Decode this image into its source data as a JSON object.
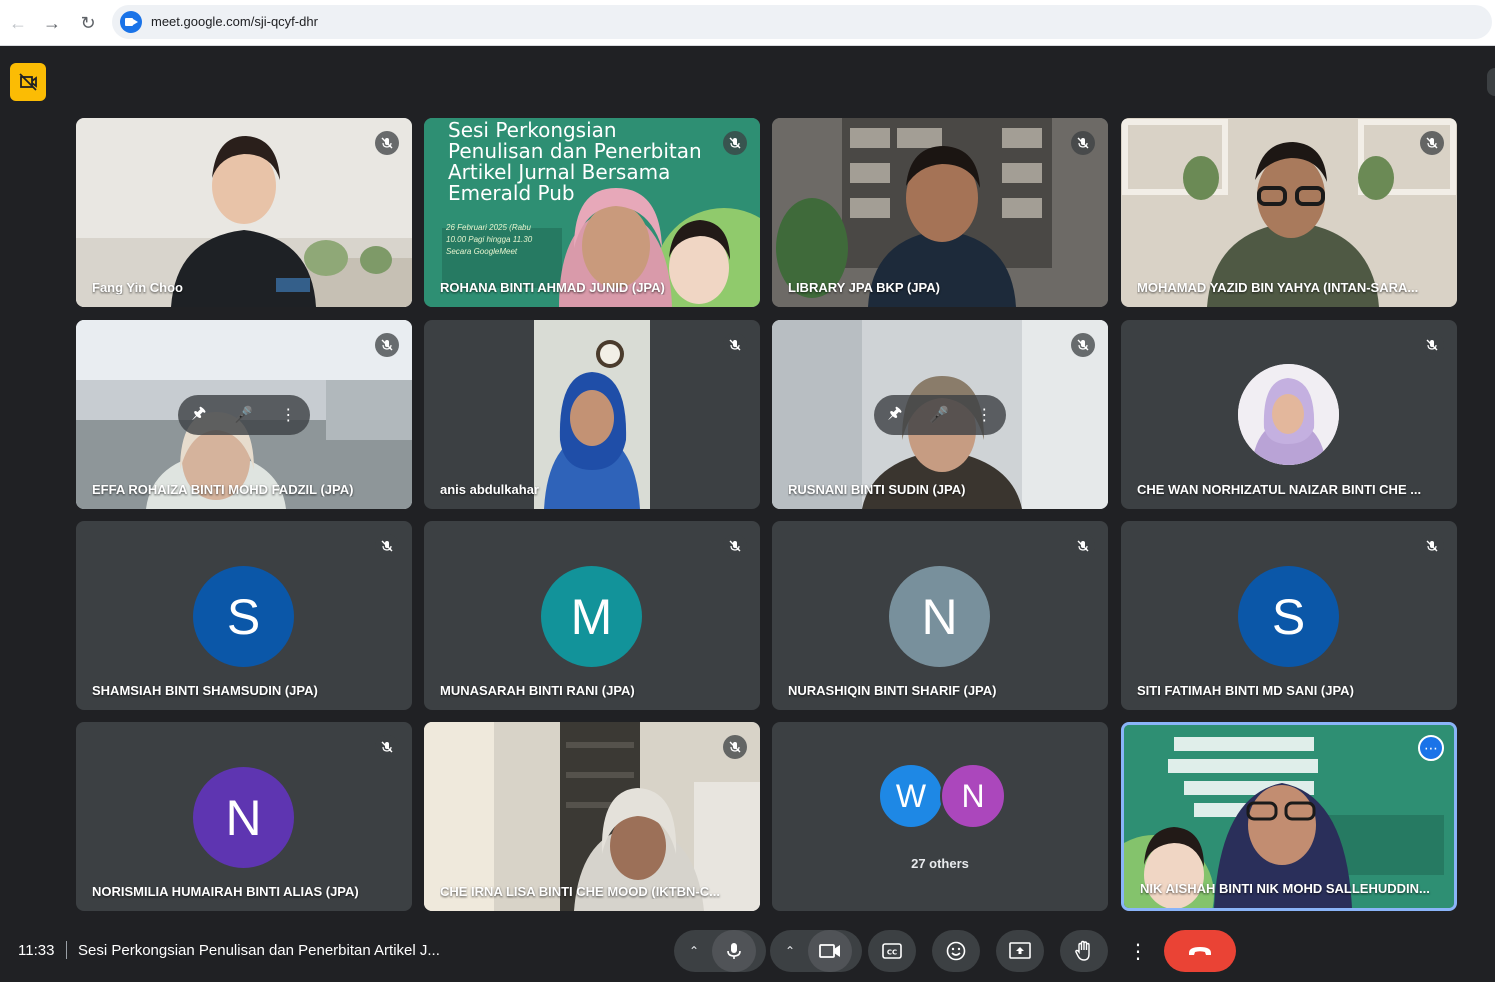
{
  "browser": {
    "url": "meet.google.com/sji-qcyf-dhr"
  },
  "tiles": [
    {
      "name": "Fang Yin Choo"
    },
    {
      "name": "ROHANA BINTI AHMAD JUNID (JPA)"
    },
    {
      "name": "LIBRARY JPA BKP (JPA)"
    },
    {
      "name": "MOHAMAD YAZID BIN YAHYA (INTAN-SARA..."
    },
    {
      "name": "EFFA ROHAIZA BINTI MOHD FADZIL (JPA)"
    },
    {
      "name": "anis abdulkahar"
    },
    {
      "name": "RUSNANI BINTI SUDIN (JPA)"
    },
    {
      "name": "CHE WAN NORHIZATUL NAIZAR BINTI CHE ..."
    },
    {
      "name": "SHAMSIAH BINTI SHAMSUDIN (JPA)",
      "initial": "S",
      "color": "#0b57a8"
    },
    {
      "name": "MUNASARAH BINTI RANI (JPA)",
      "initial": "M",
      "color": "#12939a"
    },
    {
      "name": "NURASHIQIN BINTI SHARIF (JPA)",
      "initial": "N",
      "color": "#78909c"
    },
    {
      "name": "SITI FATIMAH BINTI MD SANI (JPA)",
      "initial": "S",
      "color": "#0b57a8"
    },
    {
      "name": "NORISMILIA HUMAIRAH BINTI ALIAS (JPA)",
      "initial": "N",
      "color": "#5e35b1"
    },
    {
      "name": "CHE IRNA LISA BINTI CHE MOOD (IKTBN-C..."
    },
    {
      "others_label": "27 others",
      "others": [
        {
          "initial": "W",
          "color": "#1e88e5"
        },
        {
          "initial": "N",
          "color": "#ab47bc"
        }
      ]
    },
    {
      "name": "NIK AISHAH BINTI NIK MOHD SALLEHUDDIN..."
    }
  ],
  "banner": {
    "line1": "Sesi Perkongsian",
    "line2": "Penulisan dan Penerbitan",
    "line3": "Artikel Jurnal Bersama",
    "line4": "Emerald Pub",
    "date": "26 Februari 2025 (Rabu",
    "time": "10.00 Pagi hingga 11.30",
    "platform": "Secara GoogleMeet"
  },
  "bottom": {
    "clock": "11:33",
    "title": "Sesi Perkongsian Penulisan dan Penerbitan Artikel J..."
  },
  "colors": {
    "background": "#202124",
    "tile": "#3c4043",
    "end_call": "#ea4335",
    "accent": "#1a73e8",
    "badge": "#fbbc04"
  }
}
